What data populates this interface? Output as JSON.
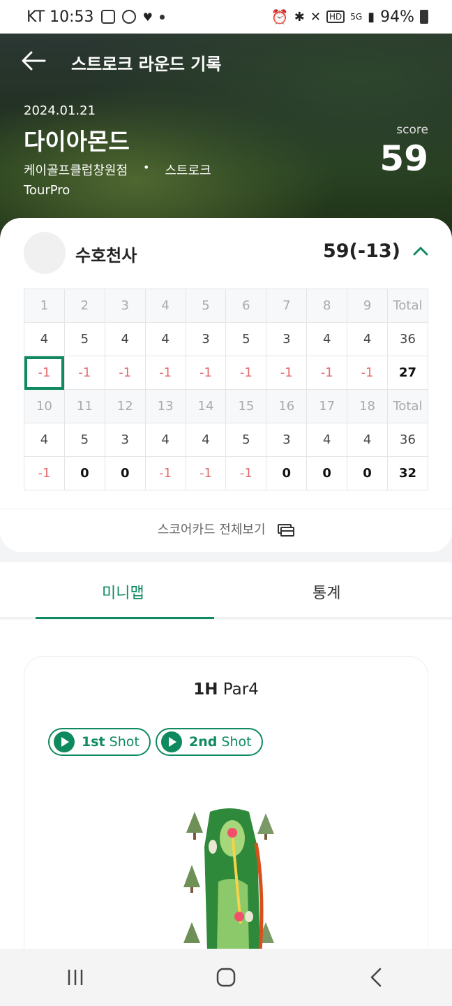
{
  "status": {
    "carrier_time": "KT 10:53",
    "battery": "94%"
  },
  "header": {
    "title": "스트로크 라운드 기록",
    "date": "2024.01.21",
    "course": "다이아몬드",
    "club": "케이골프클럽창원점",
    "separator": "•",
    "mode": "스트로크",
    "tour": "TourPro",
    "score_label": "score",
    "score": "59"
  },
  "player": {
    "name": "수호천사",
    "total": "59(-13)"
  },
  "scorecard": {
    "front_holes": [
      "1",
      "2",
      "3",
      "4",
      "5",
      "6",
      "7",
      "8",
      "9",
      "Total"
    ],
    "front_par": [
      "4",
      "5",
      "4",
      "4",
      "3",
      "5",
      "3",
      "4",
      "4",
      "36"
    ],
    "front_score": [
      "-1",
      "-1",
      "-1",
      "-1",
      "-1",
      "-1",
      "-1",
      "-1",
      "-1",
      "27"
    ],
    "back_holes": [
      "10",
      "11",
      "12",
      "13",
      "14",
      "15",
      "16",
      "17",
      "18",
      "Total"
    ],
    "back_par": [
      "4",
      "5",
      "3",
      "4",
      "4",
      "5",
      "3",
      "4",
      "4",
      "36"
    ],
    "back_score": [
      "-1",
      "0",
      "0",
      "-1",
      "-1",
      "-1",
      "0",
      "0",
      "0",
      "32"
    ]
  },
  "full_scorecard_label": "스코어카드 전체보기",
  "tabs": {
    "minimap": "미니맵",
    "stats": "통계"
  },
  "hole": {
    "number": "1H",
    "par": "Par4"
  },
  "shots": [
    {
      "num": "1st",
      "label": "Shot"
    },
    {
      "num": "2nd",
      "label": "Shot"
    }
  ],
  "colors": {
    "accent": "#0f8a5f",
    "negative": "#e46b6b"
  }
}
